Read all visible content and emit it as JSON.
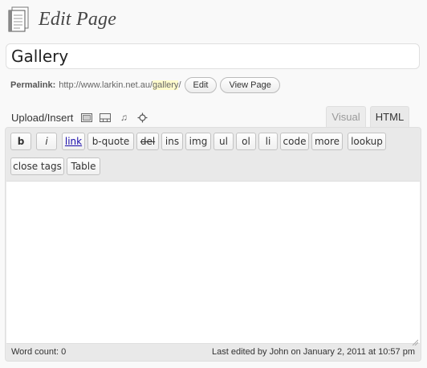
{
  "header": {
    "title": "Edit Page",
    "icon": "page-icon"
  },
  "post": {
    "title": "Gallery"
  },
  "permalink": {
    "label": "Permalink:",
    "url_base": "http://www.larkin.net.au/",
    "slug": "gallery",
    "url_trailing": "/",
    "edit_label": "Edit",
    "view_label": "View Page"
  },
  "media": {
    "label": "Upload/Insert",
    "icons": [
      "image-upload-icon",
      "video-upload-icon",
      "audio-upload-icon",
      "media-upload-icon"
    ]
  },
  "tabs": [
    {
      "label": "Visual",
      "active": false
    },
    {
      "label": "HTML",
      "active": true
    }
  ],
  "quicktags": {
    "row1": [
      "b",
      "i",
      "link",
      "b-quote",
      "del",
      "ins",
      "img",
      "ul",
      "ol",
      "li",
      "code",
      "more",
      "lookup"
    ],
    "row2": [
      "close tags",
      "Table"
    ]
  },
  "status": {
    "word_count": "Word count: 0",
    "last_edited": "Last edited by John on January 2, 2011 at 10:57 pm"
  },
  "colors": {
    "slug_highlight": "#fffbcc",
    "link": "#1a0dab",
    "toolbar_bg": "#e9e9e9"
  }
}
